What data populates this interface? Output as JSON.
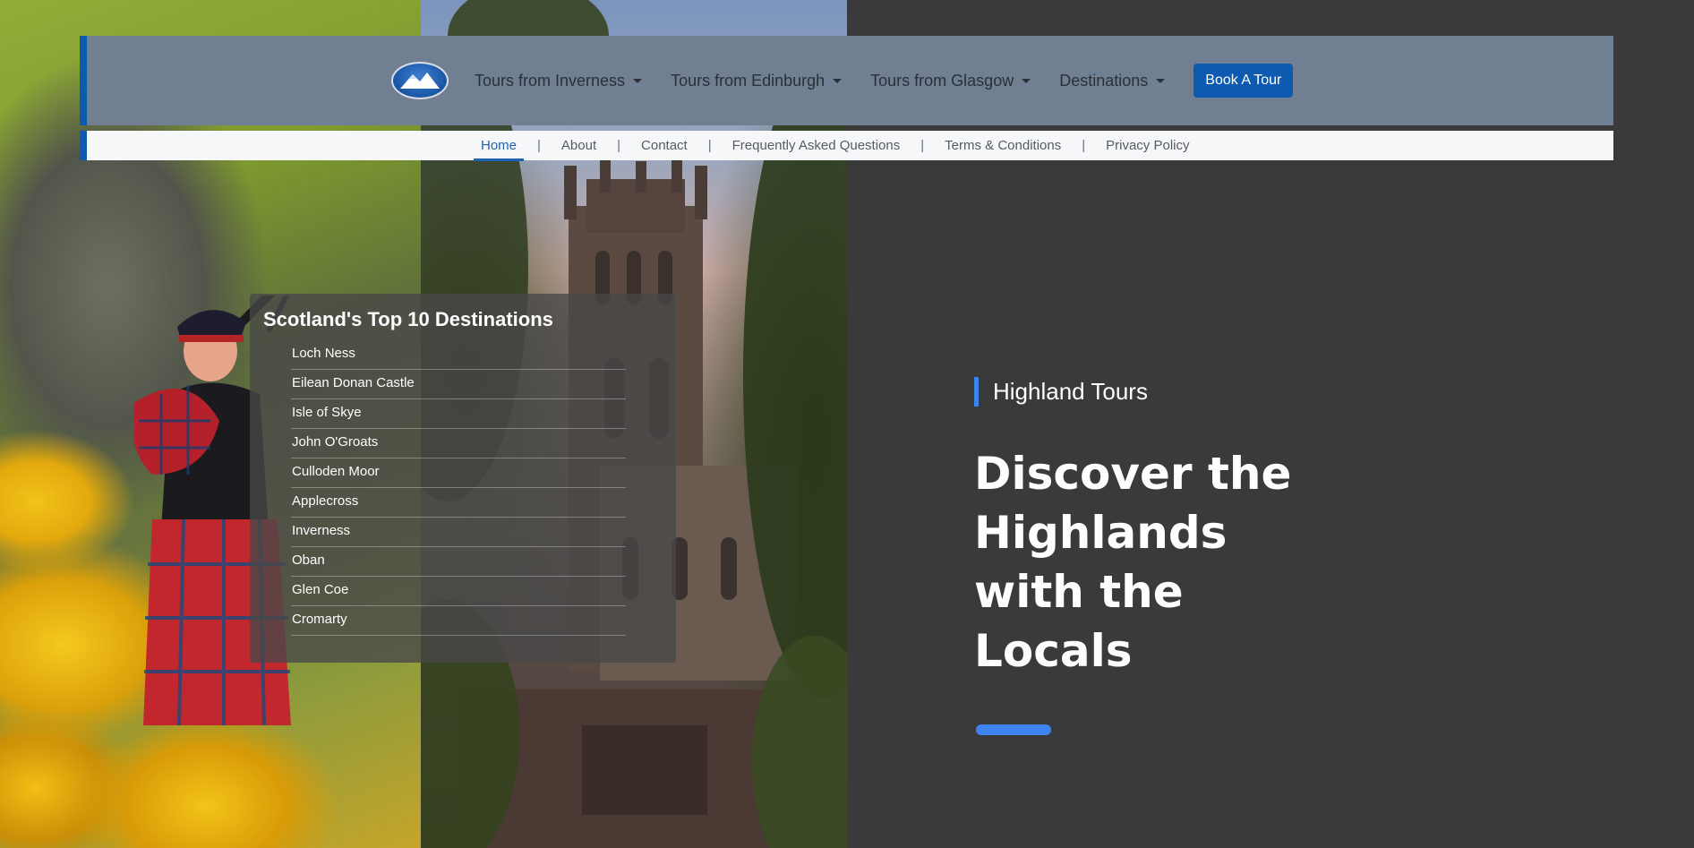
{
  "navbar": {
    "logo_name": "mountain-logo",
    "links": [
      {
        "label": "Tours from Inverness"
      },
      {
        "label": "Tours from Edinburgh"
      },
      {
        "label": "Tours from Glasgow"
      },
      {
        "label": "Destinations"
      }
    ],
    "book_button": "Book A Tour",
    "accent_color": "#0d5ab0"
  },
  "subnav": {
    "links": [
      {
        "label": "Home",
        "active": true
      },
      {
        "label": "About"
      },
      {
        "label": "Contact"
      },
      {
        "label": "Frequently Asked Questions"
      },
      {
        "label": "Terms & Conditions"
      },
      {
        "label": "Privacy Policy"
      }
    ],
    "separator": "|"
  },
  "destinations": {
    "title": "Scotland's Top 10 Destinations",
    "items": [
      "Loch Ness",
      "Eilean Donan Castle",
      "Isle of Skye",
      "John O'Groats",
      "Culloden Moor",
      "Applecross",
      "Inverness",
      "Oban",
      "Glen Coe",
      "Cromarty"
    ]
  },
  "hero": {
    "eyebrow": "Highland Tours",
    "title": "Discover the Highlands with the Locals",
    "accent_color": "#3d84f0"
  }
}
